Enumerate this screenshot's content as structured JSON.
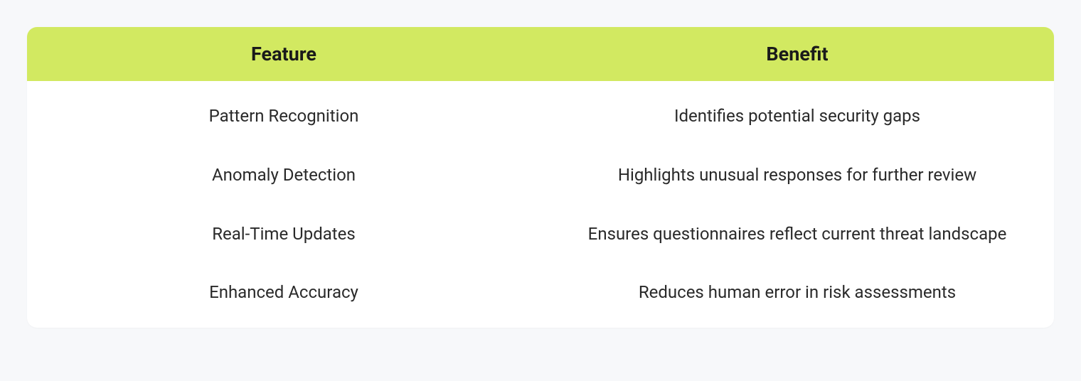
{
  "table": {
    "headers": {
      "feature": "Feature",
      "benefit": "Benefit"
    },
    "rows": [
      {
        "feature": "Pattern Recognition",
        "benefit": "Identifies potential security gaps"
      },
      {
        "feature": "Anomaly Detection",
        "benefit": "Highlights unusual responses for further review"
      },
      {
        "feature": "Real-Time Updates",
        "benefit": "Ensures questionnaires reflect current threat landscape"
      },
      {
        "feature": "Enhanced Accuracy",
        "benefit": "Reduces human error in risk assessments"
      }
    ]
  }
}
